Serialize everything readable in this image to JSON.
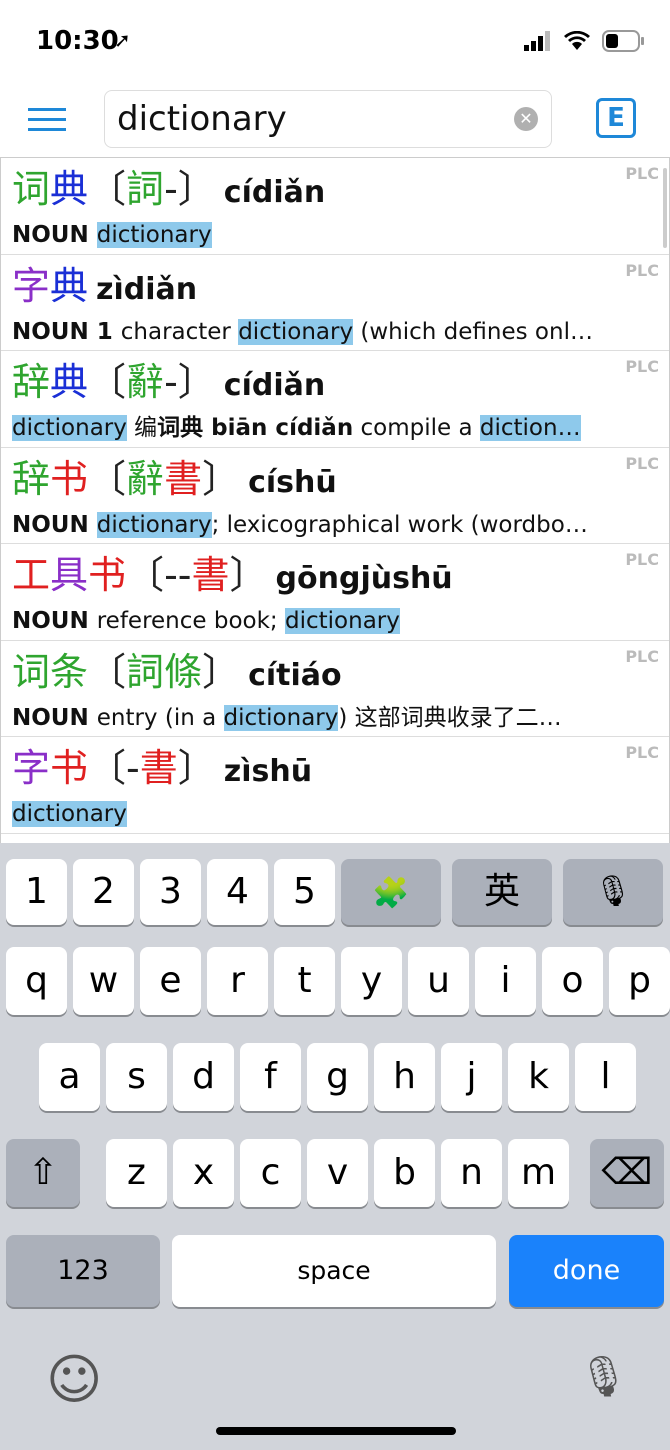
{
  "status": {
    "time": "10:30"
  },
  "header": {
    "search_value": "dictionary",
    "menu_icon": "hamburger-icon",
    "mode_button": "E"
  },
  "tone_colors": {
    "1": "#e02020",
    "2": "#2fa52f",
    "3": "#1a2fd6",
    "4": "#8a2fc8",
    "0": "#222222"
  },
  "highlight_color": "#8ec9eb",
  "entries": [
    {
      "chars": [
        {
          "c": "词",
          "t": "2"
        },
        {
          "c": "典",
          "t": "3"
        }
      ],
      "trad": [
        {
          "c": "詞",
          "t": "2"
        },
        {
          "c": "-",
          "t": "0"
        }
      ],
      "pinyin": "cídiǎn",
      "source": "PLC",
      "def": [
        {
          "s": "NOUN ",
          "k": "pos"
        },
        {
          "s": "dictionary",
          "k": "hl"
        }
      ]
    },
    {
      "chars": [
        {
          "c": "字",
          "t": "4"
        },
        {
          "c": "典",
          "t": "3"
        }
      ],
      "trad": null,
      "pinyin": "zìdiǎn",
      "source": "PLC",
      "def": [
        {
          "s": "NOUN  1 ",
          "k": "pos"
        },
        {
          "s": "character ",
          "k": ""
        },
        {
          "s": "dictionary",
          "k": "hl"
        },
        {
          "s": " (which defines onl…",
          "k": ""
        }
      ]
    },
    {
      "chars": [
        {
          "c": "辞",
          "t": "2"
        },
        {
          "c": "典",
          "t": "3"
        }
      ],
      "trad": [
        {
          "c": "辭",
          "t": "2"
        },
        {
          "c": "-",
          "t": "0"
        }
      ],
      "pinyin": "cídiǎn",
      "source": "PLC",
      "def": [
        {
          "s": "dictionary",
          "k": "hl"
        },
        {
          "s": "  编",
          "k": ""
        },
        {
          "s": "词典  biān cídiǎn",
          "k": "pos"
        },
        {
          "s": "  compile a ",
          "k": ""
        },
        {
          "s": "diction…",
          "k": "hl"
        }
      ]
    },
    {
      "chars": [
        {
          "c": "辞",
          "t": "2"
        },
        {
          "c": "书",
          "t": "1"
        }
      ],
      "trad": [
        {
          "c": "辭",
          "t": "2"
        },
        {
          "c": "書",
          "t": "1"
        }
      ],
      "pinyin": "císhū",
      "source": "PLC",
      "def": [
        {
          "s": "NOUN ",
          "k": "pos"
        },
        {
          "s": "dictionary",
          "k": "hl"
        },
        {
          "s": "; lexicographical work (wordbo…",
          "k": ""
        }
      ]
    },
    {
      "chars": [
        {
          "c": "工",
          "t": "1"
        },
        {
          "c": "具",
          "t": "4"
        },
        {
          "c": "书",
          "t": "1"
        }
      ],
      "trad": [
        {
          "c": "-",
          "t": "0"
        },
        {
          "c": "-",
          "t": "0"
        },
        {
          "c": "書",
          "t": "1"
        }
      ],
      "pinyin": "gōngjùshū",
      "source": "PLC",
      "def": [
        {
          "s": "NOUN ",
          "k": "pos"
        },
        {
          "s": "reference book; ",
          "k": ""
        },
        {
          "s": "dictionary",
          "k": "hl"
        }
      ]
    },
    {
      "chars": [
        {
          "c": "词",
          "t": "2"
        },
        {
          "c": "条",
          "t": "2"
        }
      ],
      "trad": [
        {
          "c": "詞",
          "t": "2"
        },
        {
          "c": "條",
          "t": "2"
        }
      ],
      "pinyin": "cítiáo",
      "source": "PLC",
      "def": [
        {
          "s": "NOUN ",
          "k": "pos"
        },
        {
          "s": "entry (in a ",
          "k": ""
        },
        {
          "s": "dictionary",
          "k": "hl"
        },
        {
          "s": ")  这部词典收录了二…",
          "k": ""
        }
      ]
    },
    {
      "chars": [
        {
          "c": "字",
          "t": "4"
        },
        {
          "c": "书",
          "t": "1"
        }
      ],
      "trad": [
        {
          "c": "-",
          "t": "0"
        },
        {
          "c": "書",
          "t": "1"
        }
      ],
      "pinyin": "zìshū",
      "source": "PLC",
      "def": [
        {
          "s": "dictionary",
          "k": "hl"
        }
      ]
    }
  ],
  "keyboard": {
    "row0": [
      "1",
      "2",
      "3",
      "4",
      "5"
    ],
    "puzzle_icon": "puzzle-icon",
    "lang_key": "英",
    "dictation_icon": "microphone-icon",
    "row1": [
      "q",
      "w",
      "e",
      "r",
      "t",
      "y",
      "u",
      "i",
      "o",
      "p"
    ],
    "row2": [
      "a",
      "s",
      "d",
      "f",
      "g",
      "h",
      "j",
      "k",
      "l"
    ],
    "row3": [
      "z",
      "x",
      "c",
      "v",
      "b",
      "n",
      "m"
    ],
    "numbers_key": "123",
    "space_key": "space",
    "done_key": "done",
    "done_color": "#1a82fb"
  }
}
